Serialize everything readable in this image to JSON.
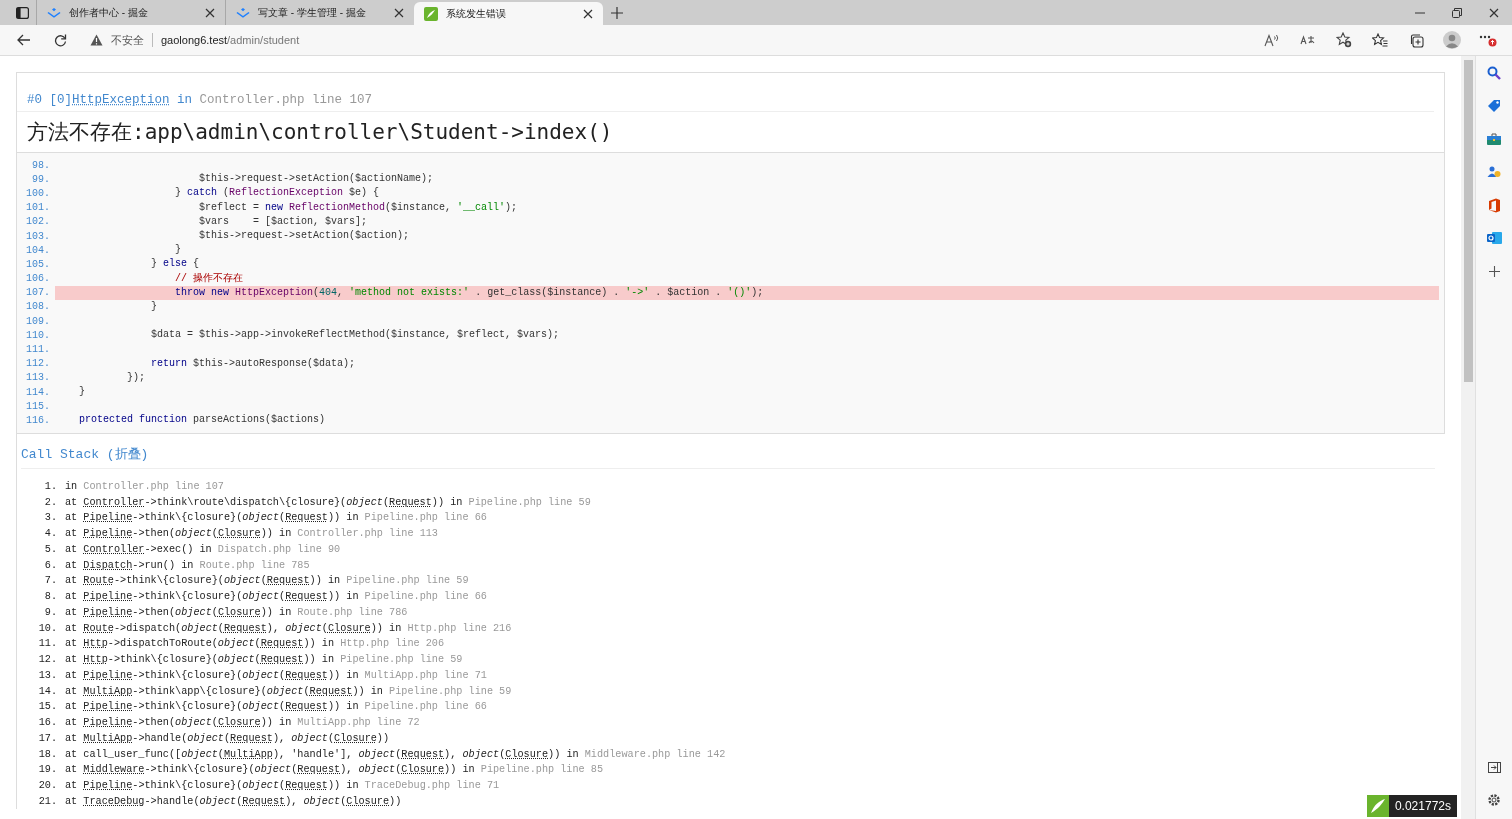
{
  "tabs": [
    {
      "kind": "juejin",
      "title": "创作者中心 - 掘金",
      "selected": false
    },
    {
      "kind": "juejin",
      "title": "写文章 - 学生管理 - 掘金",
      "selected": false
    },
    {
      "kind": "thinkphp",
      "title": "系统发生错误",
      "selected": true
    }
  ],
  "address": {
    "security": "不安全",
    "host": "gaolong6.test",
    "path": "/admin/student"
  },
  "exception": {
    "index": "#0 [0]",
    "class": "HttpException",
    "in": "in",
    "location": "Controller.php line 107",
    "message": "方法不存在:app\\admin\\controller\\Student->index()"
  },
  "source": [
    {
      "number": "98.",
      "highlighted": false
    },
    {
      "number": "99.",
      "highlighted": false,
      "segments": [
        {
          "kind": "plain",
          "text": "                        $this->request->setAction($actionName);"
        }
      ]
    },
    {
      "number": "100.",
      "highlighted": false,
      "segments": [
        {
          "kind": "plain",
          "text": "                    } "
        },
        {
          "kind": "keyword",
          "text": "catch"
        },
        {
          "kind": "plain",
          "text": " ("
        },
        {
          "kind": "class",
          "text": "ReflectionException"
        },
        {
          "kind": "plain",
          "text": " $e) {"
        }
      ]
    },
    {
      "number": "101.",
      "highlighted": false,
      "segments": [
        {
          "kind": "plain",
          "text": "                        $reflect = "
        },
        {
          "kind": "keyword",
          "text": "new "
        },
        {
          "kind": "class",
          "text": "ReflectionMethod"
        },
        {
          "kind": "plain",
          "text": "($instance, "
        },
        {
          "kind": "string",
          "text": "'__call'"
        },
        {
          "kind": "plain",
          "text": ");"
        }
      ]
    },
    {
      "number": "102.",
      "highlighted": false,
      "segments": [
        {
          "kind": "plain",
          "text": "                        $vars    = [$action, $vars];"
        }
      ]
    },
    {
      "number": "103.",
      "highlighted": false,
      "segments": [
        {
          "kind": "plain",
          "text": "                        $this->request->setAction($action);"
        }
      ]
    },
    {
      "number": "104.",
      "highlighted": false,
      "segments": [
        {
          "kind": "plain",
          "text": "                    }"
        }
      ]
    },
    {
      "number": "105.",
      "highlighted": false,
      "segments": [
        {
          "kind": "plain",
          "text": "                } "
        },
        {
          "kind": "keyword",
          "text": "else"
        },
        {
          "kind": "plain",
          "text": " {"
        }
      ]
    },
    {
      "number": "106.",
      "highlighted": false,
      "segments": [
        {
          "kind": "comment",
          "text": "                    // 操作不存在"
        }
      ]
    },
    {
      "number": "107.",
      "highlighted": true,
      "segments": [
        {
          "kind": "keyword",
          "text": "                    throw new "
        },
        {
          "kind": "class",
          "text": "HttpException"
        },
        {
          "kind": "plain",
          "text": "("
        },
        {
          "kind": "number",
          "text": "404"
        },
        {
          "kind": "plain",
          "text": ", "
        },
        {
          "kind": "string",
          "text": "'method not exists:'"
        },
        {
          "kind": "plain",
          "text": " . get_class($instance) . "
        },
        {
          "kind": "string",
          "text": "'->'"
        },
        {
          "kind": "plain",
          "text": " . $action . "
        },
        {
          "kind": "string",
          "text": "'()'"
        },
        {
          "kind": "plain",
          "text": ");"
        }
      ]
    },
    {
      "number": "108.",
      "highlighted": false,
      "segments": [
        {
          "kind": "plain",
          "text": "                }"
        }
      ]
    },
    {
      "number": "109.",
      "highlighted": false
    },
    {
      "number": "110.",
      "highlighted": false,
      "segments": [
        {
          "kind": "plain",
          "text": "                $data = $this->app->invokeReflectMethod($instance, $reflect, $vars);"
        }
      ]
    },
    {
      "number": "111.",
      "highlighted": false
    },
    {
      "number": "112.",
      "highlighted": false,
      "segments": [
        {
          "kind": "keyword",
          "text": "                return"
        },
        {
          "kind": "plain",
          "text": " $this->autoResponse($data);"
        }
      ]
    },
    {
      "number": "113.",
      "highlighted": false,
      "segments": [
        {
          "kind": "plain",
          "text": "            });"
        }
      ]
    },
    {
      "number": "114.",
      "highlighted": false,
      "segments": [
        {
          "kind": "plain",
          "text": "    }"
        }
      ]
    },
    {
      "number": "115.",
      "highlighted": false
    },
    {
      "number": "116.",
      "highlighted": false,
      "segments": [
        {
          "kind": "keyword",
          "text": "    protected function"
        },
        {
          "kind": "plain",
          "text": " parseActions($actions)"
        }
      ]
    }
  ],
  "call_stack": {
    "title": "Call Stack (折叠)",
    "frames": [
      {
        "number": "1.",
        "segments": [
          {
            "kind": "text",
            "text": "in "
          },
          {
            "kind": "file",
            "text": "Controller.php line 107"
          }
        ]
      },
      {
        "number": "2.",
        "segments": [
          {
            "kind": "text",
            "text": "at "
          },
          {
            "kind": "class",
            "text": "Controller"
          },
          {
            "kind": "text",
            "text": "->think\\route\\dispatch\\{closure}("
          },
          {
            "kind": "arg",
            "text": "object"
          },
          {
            "kind": "text",
            "text": "("
          },
          {
            "kind": "class",
            "text": "Request"
          },
          {
            "kind": "text",
            "text": ")) in "
          },
          {
            "kind": "file",
            "text": "Pipeline.php line 59"
          }
        ]
      },
      {
        "number": "3.",
        "segments": [
          {
            "kind": "text",
            "text": "at "
          },
          {
            "kind": "class",
            "text": "Pipeline"
          },
          {
            "kind": "text",
            "text": "->think\\{closure}("
          },
          {
            "kind": "arg",
            "text": "object"
          },
          {
            "kind": "text",
            "text": "("
          },
          {
            "kind": "class",
            "text": "Request"
          },
          {
            "kind": "text",
            "text": ")) in "
          },
          {
            "kind": "file",
            "text": "Pipeline.php line 66"
          }
        ]
      },
      {
        "number": "4.",
        "segments": [
          {
            "kind": "text",
            "text": "at "
          },
          {
            "kind": "class",
            "text": "Pipeline"
          },
          {
            "kind": "text",
            "text": "->then("
          },
          {
            "kind": "arg",
            "text": "object"
          },
          {
            "kind": "text",
            "text": "("
          },
          {
            "kind": "class",
            "text": "Closure"
          },
          {
            "kind": "text",
            "text": ")) in "
          },
          {
            "kind": "file",
            "text": "Controller.php line 113"
          }
        ]
      },
      {
        "number": "5.",
        "segments": [
          {
            "kind": "text",
            "text": "at "
          },
          {
            "kind": "class",
            "text": "Controller"
          },
          {
            "kind": "text",
            "text": "->exec() in "
          },
          {
            "kind": "file",
            "text": "Dispatch.php line 90"
          }
        ]
      },
      {
        "number": "6.",
        "segments": [
          {
            "kind": "text",
            "text": "at "
          },
          {
            "kind": "class",
            "text": "Dispatch"
          },
          {
            "kind": "text",
            "text": "->run() in "
          },
          {
            "kind": "file",
            "text": "Route.php line 785"
          }
        ]
      },
      {
        "number": "7.",
        "segments": [
          {
            "kind": "text",
            "text": "at "
          },
          {
            "kind": "class",
            "text": "Route"
          },
          {
            "kind": "text",
            "text": "->think\\{closure}("
          },
          {
            "kind": "arg",
            "text": "object"
          },
          {
            "kind": "text",
            "text": "("
          },
          {
            "kind": "class",
            "text": "Request"
          },
          {
            "kind": "text",
            "text": ")) in "
          },
          {
            "kind": "file",
            "text": "Pipeline.php line 59"
          }
        ]
      },
      {
        "number": "8.",
        "segments": [
          {
            "kind": "text",
            "text": "at "
          },
          {
            "kind": "class",
            "text": "Pipeline"
          },
          {
            "kind": "text",
            "text": "->think\\{closure}("
          },
          {
            "kind": "arg",
            "text": "object"
          },
          {
            "kind": "text",
            "text": "("
          },
          {
            "kind": "class",
            "text": "Request"
          },
          {
            "kind": "text",
            "text": ")) in "
          },
          {
            "kind": "file",
            "text": "Pipeline.php line 66"
          }
        ]
      },
      {
        "number": "9.",
        "segments": [
          {
            "kind": "text",
            "text": "at "
          },
          {
            "kind": "class",
            "text": "Pipeline"
          },
          {
            "kind": "text",
            "text": "->then("
          },
          {
            "kind": "arg",
            "text": "object"
          },
          {
            "kind": "text",
            "text": "("
          },
          {
            "kind": "class",
            "text": "Closure"
          },
          {
            "kind": "text",
            "text": ")) in "
          },
          {
            "kind": "file",
            "text": "Route.php line 786"
          }
        ]
      },
      {
        "number": "10.",
        "segments": [
          {
            "kind": "text",
            "text": "at "
          },
          {
            "kind": "class",
            "text": "Route"
          },
          {
            "kind": "text",
            "text": "->dispatch("
          },
          {
            "kind": "arg",
            "text": "object"
          },
          {
            "kind": "text",
            "text": "("
          },
          {
            "kind": "class",
            "text": "Request"
          },
          {
            "kind": "text",
            "text": "), "
          },
          {
            "kind": "arg",
            "text": "object"
          },
          {
            "kind": "text",
            "text": "("
          },
          {
            "kind": "class",
            "text": "Closure"
          },
          {
            "kind": "text",
            "text": ")) in "
          },
          {
            "kind": "file",
            "text": "Http.php line 216"
          }
        ]
      },
      {
        "number": "11.",
        "segments": [
          {
            "kind": "text",
            "text": "at "
          },
          {
            "kind": "class",
            "text": "Http"
          },
          {
            "kind": "text",
            "text": "->dispatchToRoute("
          },
          {
            "kind": "arg",
            "text": "object"
          },
          {
            "kind": "text",
            "text": "("
          },
          {
            "kind": "class",
            "text": "Request"
          },
          {
            "kind": "text",
            "text": ")) in "
          },
          {
            "kind": "file",
            "text": "Http.php line 206"
          }
        ]
      },
      {
        "number": "12.",
        "segments": [
          {
            "kind": "text",
            "text": "at "
          },
          {
            "kind": "class",
            "text": "Http"
          },
          {
            "kind": "text",
            "text": "->think\\{closure}("
          },
          {
            "kind": "arg",
            "text": "object"
          },
          {
            "kind": "text",
            "text": "("
          },
          {
            "kind": "class",
            "text": "Request"
          },
          {
            "kind": "text",
            "text": ")) in "
          },
          {
            "kind": "file",
            "text": "Pipeline.php line 59"
          }
        ]
      },
      {
        "number": "13.",
        "segments": [
          {
            "kind": "text",
            "text": "at "
          },
          {
            "kind": "class",
            "text": "Pipeline"
          },
          {
            "kind": "text",
            "text": "->think\\{closure}("
          },
          {
            "kind": "arg",
            "text": "object"
          },
          {
            "kind": "text",
            "text": "("
          },
          {
            "kind": "class",
            "text": "Request"
          },
          {
            "kind": "text",
            "text": ")) in "
          },
          {
            "kind": "file",
            "text": "MultiApp.php line 71"
          }
        ]
      },
      {
        "number": "14.",
        "segments": [
          {
            "kind": "text",
            "text": "at "
          },
          {
            "kind": "class",
            "text": "MultiApp"
          },
          {
            "kind": "text",
            "text": "->think\\app\\{closure}("
          },
          {
            "kind": "arg",
            "text": "object"
          },
          {
            "kind": "text",
            "text": "("
          },
          {
            "kind": "class",
            "text": "Request"
          },
          {
            "kind": "text",
            "text": ")) in "
          },
          {
            "kind": "file",
            "text": "Pipeline.php line 59"
          }
        ]
      },
      {
        "number": "15.",
        "segments": [
          {
            "kind": "text",
            "text": "at "
          },
          {
            "kind": "class",
            "text": "Pipeline"
          },
          {
            "kind": "text",
            "text": "->think\\{closure}("
          },
          {
            "kind": "arg",
            "text": "object"
          },
          {
            "kind": "text",
            "text": "("
          },
          {
            "kind": "class",
            "text": "Request"
          },
          {
            "kind": "text",
            "text": ")) in "
          },
          {
            "kind": "file",
            "text": "Pipeline.php line 66"
          }
        ]
      },
      {
        "number": "16.",
        "segments": [
          {
            "kind": "text",
            "text": "at "
          },
          {
            "kind": "class",
            "text": "Pipeline"
          },
          {
            "kind": "text",
            "text": "->then("
          },
          {
            "kind": "arg",
            "text": "object"
          },
          {
            "kind": "text",
            "text": "("
          },
          {
            "kind": "class",
            "text": "Closure"
          },
          {
            "kind": "text",
            "text": ")) in "
          },
          {
            "kind": "file",
            "text": "MultiApp.php line 72"
          }
        ]
      },
      {
        "number": "17.",
        "segments": [
          {
            "kind": "text",
            "text": "at "
          },
          {
            "kind": "class",
            "text": "MultiApp"
          },
          {
            "kind": "text",
            "text": "->handle("
          },
          {
            "kind": "arg",
            "text": "object"
          },
          {
            "kind": "text",
            "text": "("
          },
          {
            "kind": "class",
            "text": "Request"
          },
          {
            "kind": "text",
            "text": "), "
          },
          {
            "kind": "arg",
            "text": "object"
          },
          {
            "kind": "text",
            "text": "("
          },
          {
            "kind": "class",
            "text": "Closure"
          },
          {
            "kind": "text",
            "text": "))"
          }
        ]
      },
      {
        "number": "18.",
        "segments": [
          {
            "kind": "text",
            "text": "at call_user_func(["
          },
          {
            "kind": "arg",
            "text": "object"
          },
          {
            "kind": "text",
            "text": "("
          },
          {
            "kind": "class",
            "text": "MultiApp"
          },
          {
            "kind": "text",
            "text": "), 'handle'], "
          },
          {
            "kind": "arg",
            "text": "object"
          },
          {
            "kind": "text",
            "text": "("
          },
          {
            "kind": "class",
            "text": "Request"
          },
          {
            "kind": "text",
            "text": "), "
          },
          {
            "kind": "arg",
            "text": "object"
          },
          {
            "kind": "text",
            "text": "("
          },
          {
            "kind": "class",
            "text": "Closure"
          },
          {
            "kind": "text",
            "text": ")) in "
          },
          {
            "kind": "file",
            "text": "Middleware.php line 142"
          }
        ]
      },
      {
        "number": "19.",
        "segments": [
          {
            "kind": "text",
            "text": "at "
          },
          {
            "kind": "class",
            "text": "Middleware"
          },
          {
            "kind": "text",
            "text": "->think\\{closure}("
          },
          {
            "kind": "arg",
            "text": "object"
          },
          {
            "kind": "text",
            "text": "("
          },
          {
            "kind": "class",
            "text": "Request"
          },
          {
            "kind": "text",
            "text": "), "
          },
          {
            "kind": "arg",
            "text": "object"
          },
          {
            "kind": "text",
            "text": "("
          },
          {
            "kind": "class",
            "text": "Closure"
          },
          {
            "kind": "text",
            "text": ")) in "
          },
          {
            "kind": "file",
            "text": "Pipeline.php line 85"
          }
        ]
      },
      {
        "number": "20.",
        "segments": [
          {
            "kind": "text",
            "text": "at "
          },
          {
            "kind": "class",
            "text": "Pipeline"
          },
          {
            "kind": "text",
            "text": "->think\\{closure}("
          },
          {
            "kind": "arg",
            "text": "object"
          },
          {
            "kind": "text",
            "text": "("
          },
          {
            "kind": "class",
            "text": "Request"
          },
          {
            "kind": "text",
            "text": ")) in "
          },
          {
            "kind": "file",
            "text": "TraceDebug.php line 71"
          }
        ]
      },
      {
        "number": "21.",
        "segments": [
          {
            "kind": "text",
            "text": "at "
          },
          {
            "kind": "class",
            "text": "TraceDebug"
          },
          {
            "kind": "text",
            "text": "->handle("
          },
          {
            "kind": "arg",
            "text": "object"
          },
          {
            "kind": "text",
            "text": "("
          },
          {
            "kind": "class",
            "text": "Request"
          },
          {
            "kind": "text",
            "text": "), "
          },
          {
            "kind": "arg",
            "text": "object"
          },
          {
            "kind": "text",
            "text": "("
          },
          {
            "kind": "class",
            "text": "Closure"
          },
          {
            "kind": "text",
            "text": "))"
          }
        ]
      }
    ]
  },
  "trace_badge": {
    "time": "0.021772s"
  }
}
